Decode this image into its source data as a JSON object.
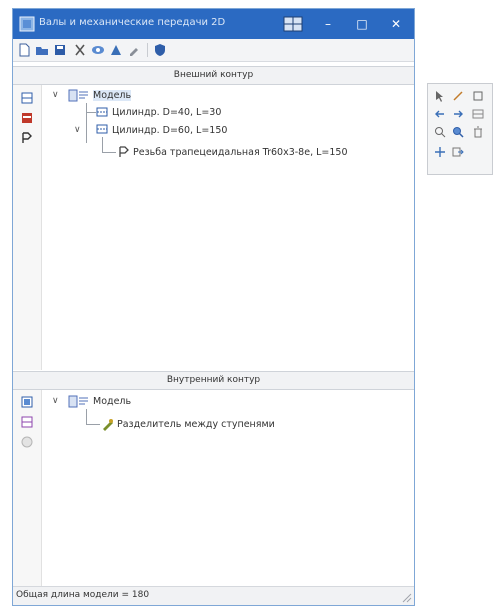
{
  "window": {
    "title": "Валы и механические передачи 2D",
    "buttons": {
      "minimize": "–",
      "maximize": "□",
      "close": "✕"
    }
  },
  "toolbar": {
    "items": [
      "new-icon",
      "open-icon",
      "save-icon",
      "cut-icon",
      "view-icon",
      "color-icon",
      "settings-icon",
      "shield-icon"
    ]
  },
  "outer_contour": {
    "header": "Внешний контур",
    "tree": {
      "root": "Модель",
      "children": [
        {
          "label": "Цилиндр. D=40, L=30"
        },
        {
          "label": "Цилиндр. D=60, L=150",
          "children": [
            {
              "label": "Резьба трапецеидальная Tr60x3-8e, L=150"
            }
          ]
        }
      ]
    }
  },
  "inner_contour": {
    "header": "Внутренний контур",
    "tree": {
      "root": "Модель",
      "children": [
        {
          "label": "Разделитель между ступенями"
        }
      ]
    }
  },
  "status": {
    "text": "Общая длина модели = 180"
  },
  "colors": {
    "titlebar": "#2b6ac2",
    "accent": "#2b6ac2"
  }
}
